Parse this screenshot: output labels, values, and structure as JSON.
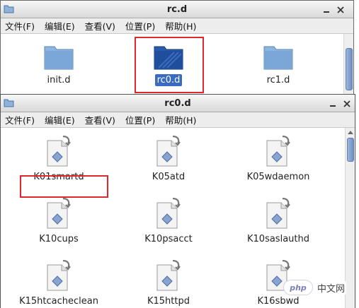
{
  "back_window": {
    "title": "rc.d",
    "menu": [
      "文件(F)",
      "编辑(E)",
      "查看(V)",
      "位置(P)",
      "帮助(H)"
    ],
    "items": [
      {
        "label": "init.d",
        "selected": false
      },
      {
        "label": "rc0.d",
        "selected": true
      },
      {
        "label": "rc1.d",
        "selected": false
      }
    ]
  },
  "front_window": {
    "title": "rc0.d",
    "menu": [
      "文件(F)",
      "编辑(E)",
      "查看(V)",
      "位置(P)",
      "帮助(H)"
    ],
    "items": [
      {
        "label": "K01smartd"
      },
      {
        "label": "K05atd"
      },
      {
        "label": "K05wdaemon"
      },
      {
        "label": "K10cups"
      },
      {
        "label": "K10psacct"
      },
      {
        "label": "K10saslauthd"
      },
      {
        "label": "K15htcacheclean"
      },
      {
        "label": "K15httpd"
      },
      {
        "label": "K16sbwd"
      }
    ]
  },
  "watermark": {
    "logo": "php",
    "text": "中文网"
  },
  "colors": {
    "highlight": "#e0282c",
    "selection": "#3a6bc0",
    "folder": "#7aa7d6",
    "folder_selected": "#1f4e9c"
  }
}
